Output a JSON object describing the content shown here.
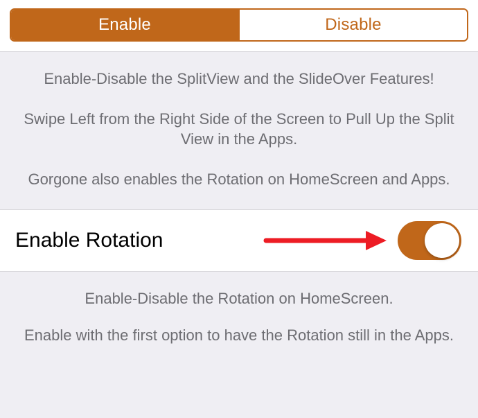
{
  "segmented": {
    "enable_label": "Enable",
    "disable_label": "Disable",
    "selected": "enable"
  },
  "description": {
    "line1": "Enable-Disable the SplitView and the SlideOver Features!",
    "line2": "Swipe Left from the Right Side of the Screen to Pull Up the Split View in the Apps.",
    "line3": "Gorgone also enables the Rotation on HomeScreen and Apps."
  },
  "rotation_row": {
    "label": "Enable Rotation",
    "toggle_on": true,
    "arrow_color": "#ed1c24",
    "accent_color": "#c0671a"
  },
  "footer": {
    "line1": "Enable-Disable the Rotation on HomeScreen.",
    "line2": "Enable with the first option to have the Rotation still in the Apps."
  }
}
